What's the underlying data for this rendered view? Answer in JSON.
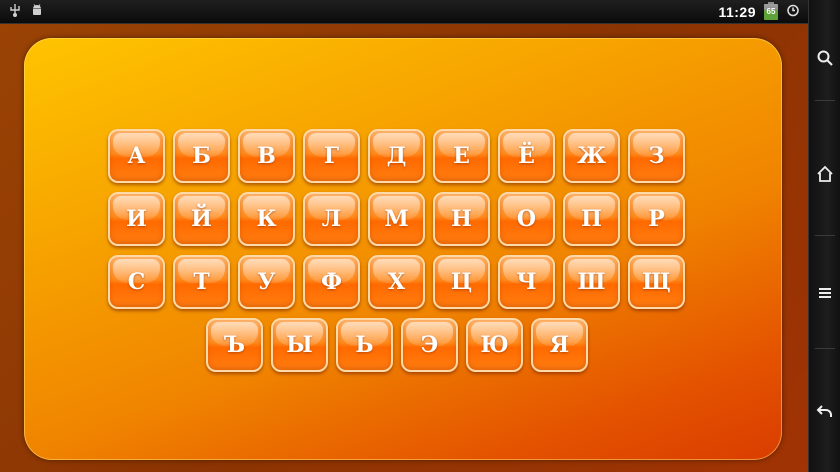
{
  "status_bar": {
    "left_icons": [
      "usb-icon",
      "android-debug-icon"
    ],
    "time": "11:29",
    "battery_level": "65",
    "alarm_icon": "alarm-clock-icon"
  },
  "nav_bar": {
    "icons": [
      "search-icon",
      "home-icon",
      "menu-icon",
      "back-icon"
    ]
  },
  "keyboard": {
    "row1": [
      "А",
      "Б",
      "В",
      "Г",
      "Д",
      "Е",
      "Ё",
      "Ж",
      "З"
    ],
    "row2": [
      "И",
      "Й",
      "К",
      "Л",
      "М",
      "Н",
      "О",
      "П",
      "Р"
    ],
    "row3": [
      "С",
      "Т",
      "У",
      "Ф",
      "Х",
      "Ц",
      "Ч",
      "Ш",
      "Щ"
    ],
    "row4": [
      "Ъ",
      "Ы",
      "Ь",
      "Э",
      "Ю",
      "Я"
    ]
  },
  "colors": {
    "background_frame": "#8b3403",
    "panel_top": "#ffc400",
    "panel_bottom": "#d93d00",
    "key_orange": "#ff7a10",
    "key_border": "#ffd9a8"
  }
}
